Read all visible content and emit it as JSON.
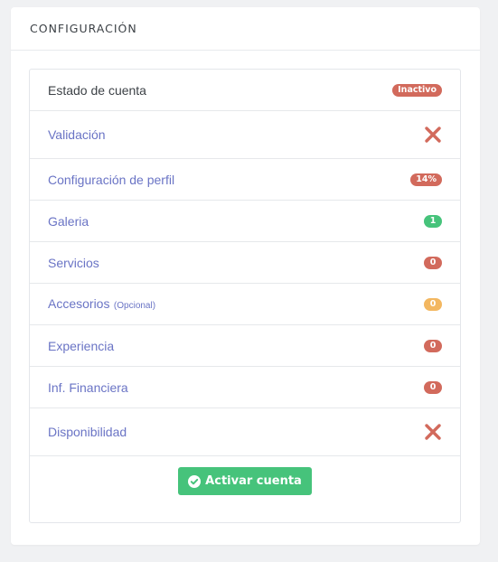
{
  "header": {
    "title": "CONFIGURACIÓN"
  },
  "status_row": {
    "label": "Estado de cuenta",
    "badge": "Inactivo"
  },
  "rows": [
    {
      "label": "Validación",
      "status": "x-icon"
    },
    {
      "label": "Configuración de perfil",
      "badge": "14%",
      "badge_color": "#d26a5c"
    },
    {
      "label": "Galeria",
      "badge": "1",
      "badge_color": "#46c37b"
    },
    {
      "label": "Servicios",
      "badge": "0",
      "badge_color": "#d26a5c"
    },
    {
      "label": "Accesorios",
      "sub": "(Opcional)",
      "badge": "0",
      "badge_color": "#f3b760"
    },
    {
      "label": "Experiencia",
      "badge": "0",
      "badge_color": "#d26a5c"
    },
    {
      "label": "Inf. Financiera",
      "badge": "0",
      "badge_color": "#d26a5c"
    },
    {
      "label": "Disponibilidad",
      "status": "x-icon"
    }
  ],
  "activate_button": {
    "label": "Activar cuenta",
    "icon": "check-circle-icon"
  },
  "colors": {
    "danger": "#d26a5c",
    "success": "#46c37b",
    "warning": "#f3b760",
    "link": "#6a74c5"
  }
}
